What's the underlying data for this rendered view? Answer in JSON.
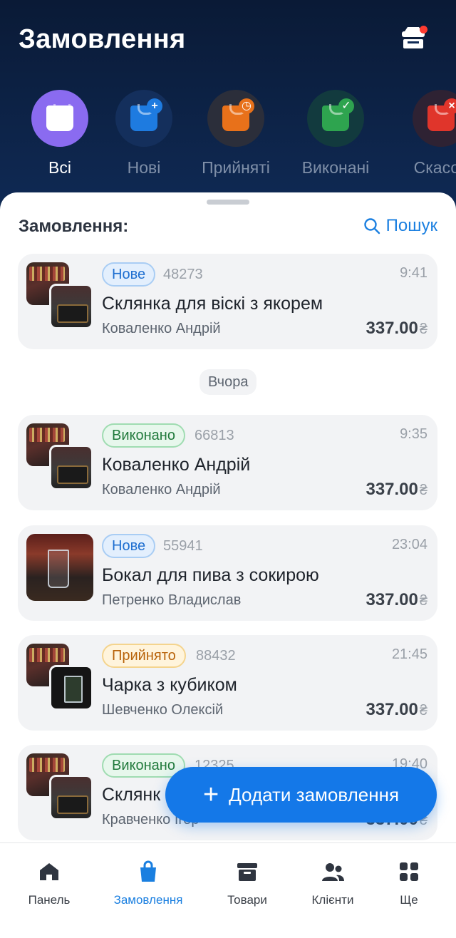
{
  "header": {
    "title": "Замовлення",
    "store_icon": "store-icon"
  },
  "filters": [
    {
      "label": "Всі",
      "icon": "bag-icon",
      "color": "#8a6bf0",
      "active": true
    },
    {
      "label": "Нові",
      "icon": "bag-plus-icon",
      "color": "#1e7be0"
    },
    {
      "label": "Прийняті",
      "icon": "bag-clock-icon",
      "color": "#e8711a"
    },
    {
      "label": "Виконані",
      "icon": "bag-check-icon",
      "color": "#2ea44f"
    },
    {
      "label": "Скасов",
      "icon": "bag-cancel-icon",
      "color": "#e0352b"
    }
  ],
  "list": {
    "title": "Замовлення:",
    "search_label": "Пошук",
    "date_divider": "Вчора"
  },
  "orders": [
    {
      "status": "Нове",
      "number": "48273",
      "time": "9:41",
      "product": "Склянка для віскі з якорем",
      "customer": "Коваленко Андрій",
      "price": "337.00",
      "currency": "₴"
    },
    {
      "status": "Виконано",
      "number": "66813",
      "time": "9:35",
      "product": "Коваленко Андрій",
      "customer": "Коваленко Андрій",
      "price": "337.00",
      "currency": "₴"
    },
    {
      "status": "Нове",
      "number": "55941",
      "time": "23:04",
      "product": "Бокал для пива з сокирою",
      "customer": "Петренко Владислав",
      "price": "337.00",
      "currency": "₴"
    },
    {
      "status": "Прийнято",
      "number": "88432",
      "time": "21:45",
      "product": "Чарка з кубиком",
      "customer": "Шевченко Олексій",
      "price": "337.00",
      "currency": "₴"
    },
    {
      "status": "Виконано",
      "number": "12325",
      "time": "19:40",
      "product": "Склянк",
      "customer": "Кравченко Ігор",
      "price": "337.00",
      "currency": "₴"
    }
  ],
  "fab": {
    "label": "Додати замовлення"
  },
  "tabbar": [
    {
      "label": "Панель",
      "icon": "home-icon"
    },
    {
      "label": "Замовлення",
      "icon": "shopping-bag-icon",
      "active": true
    },
    {
      "label": "Товари",
      "icon": "archive-box-icon"
    },
    {
      "label": "Клієнти",
      "icon": "users-icon"
    },
    {
      "label": "Ще",
      "icon": "grid-icon"
    }
  ]
}
